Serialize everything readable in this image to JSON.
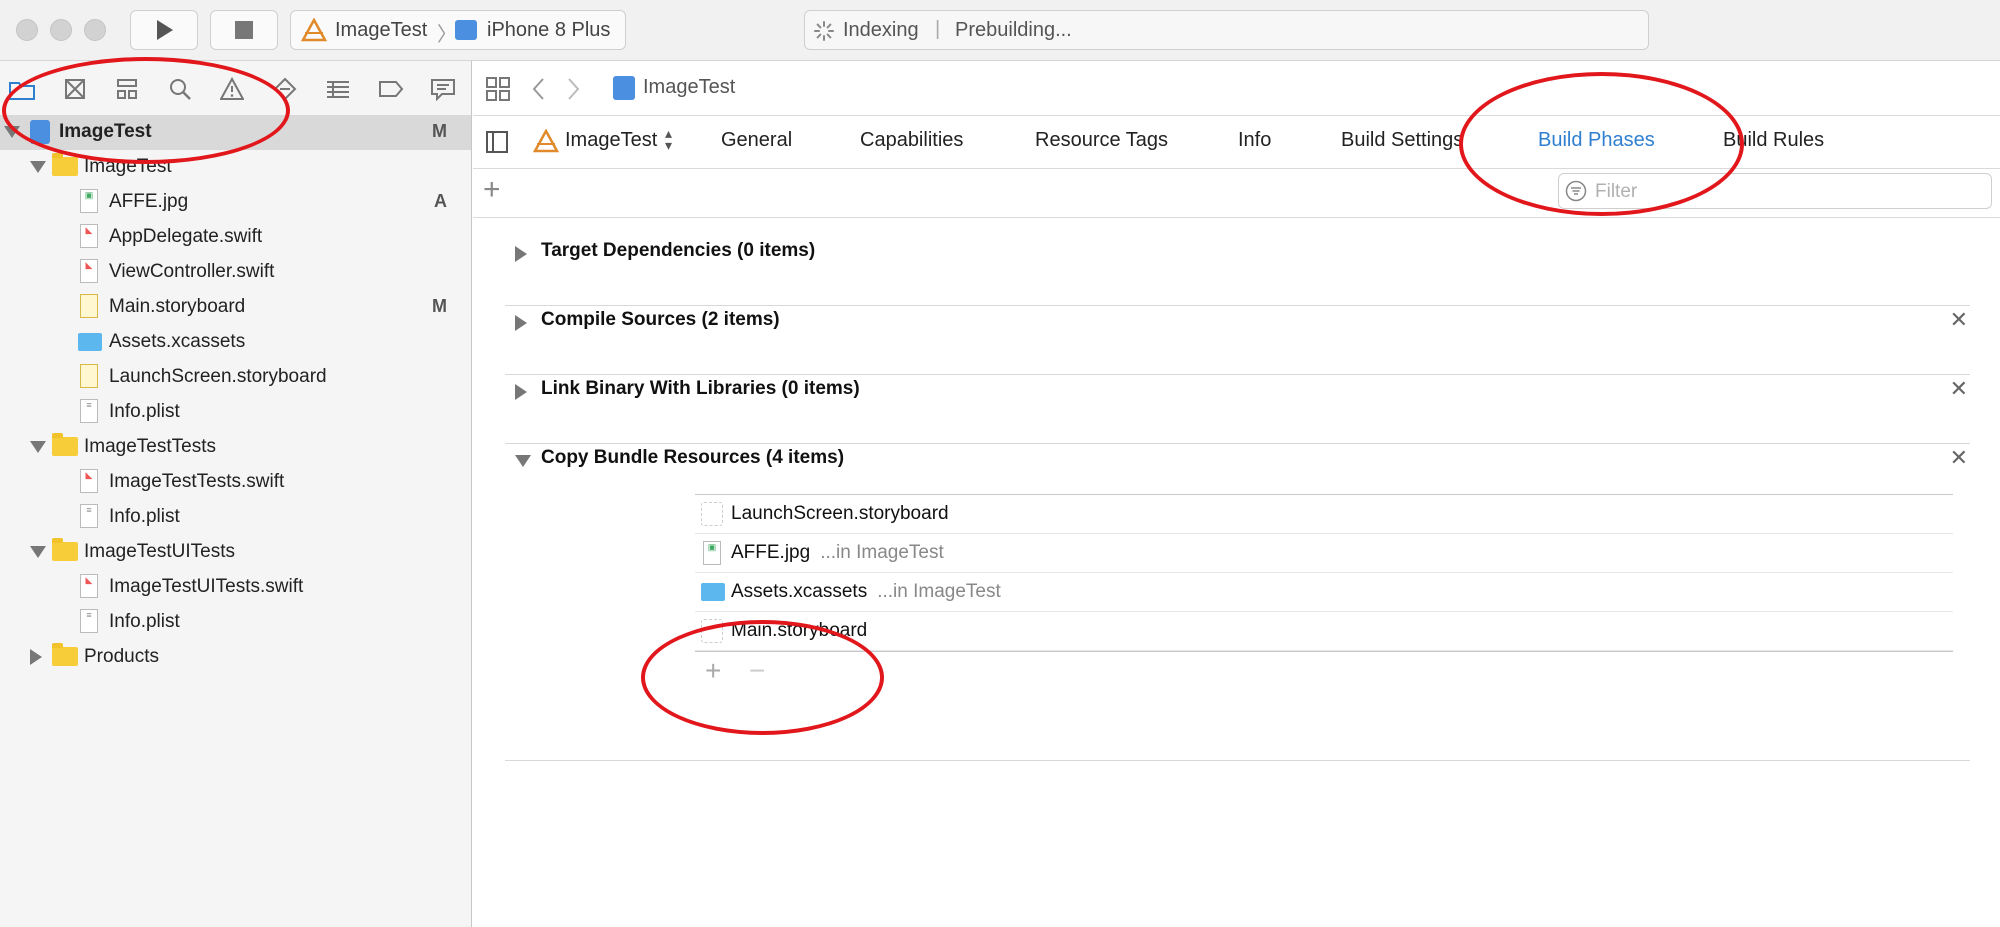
{
  "toolbar": {
    "scheme_target": "ImageTest",
    "scheme_separator": "〉",
    "scheme_device": "iPhone 8 Plus",
    "status_activity": "Indexing",
    "status_separator": "|",
    "status_detail": "Prebuilding..."
  },
  "navigator": {
    "icons": [
      "folder-icon",
      "source-control-icon",
      "symbol-icon",
      "find-icon",
      "issue-warning-icon",
      "test-icon",
      "debug-icon",
      "breakpoint-icon",
      "report-icon"
    ],
    "tree": [
      {
        "label": "ImageTest",
        "badge": "M",
        "kind": "project",
        "depth": 0,
        "expanded": true,
        "selected": true
      },
      {
        "label": "ImageTest",
        "badge": "",
        "kind": "folder",
        "depth": 1,
        "expanded": true
      },
      {
        "label": "AFFE.jpg",
        "badge": "A",
        "kind": "jpg",
        "depth": 2
      },
      {
        "label": "AppDelegate.swift",
        "badge": "",
        "kind": "swift",
        "depth": 2
      },
      {
        "label": "ViewController.swift",
        "badge": "",
        "kind": "swift",
        "depth": 2
      },
      {
        "label": "Main.storyboard",
        "badge": "M",
        "kind": "storyboard",
        "depth": 2
      },
      {
        "label": "Assets.xcassets",
        "badge": "",
        "kind": "xcassets",
        "depth": 2
      },
      {
        "label": "LaunchScreen.storyboard",
        "badge": "",
        "kind": "storyboard",
        "depth": 2
      },
      {
        "label": "Info.plist",
        "badge": "",
        "kind": "plist",
        "depth": 2
      },
      {
        "label": "ImageTestTests",
        "badge": "",
        "kind": "folder",
        "depth": 1,
        "expanded": true
      },
      {
        "label": "ImageTestTests.swift",
        "badge": "",
        "kind": "swift",
        "depth": 2
      },
      {
        "label": "Info.plist",
        "badge": "",
        "kind": "plist",
        "depth": 2
      },
      {
        "label": "ImageTestUITests",
        "badge": "",
        "kind": "folder",
        "depth": 1,
        "expanded": true
      },
      {
        "label": "ImageTestUITests.swift",
        "badge": "",
        "kind": "swift",
        "depth": 2
      },
      {
        "label": "Info.plist",
        "badge": "",
        "kind": "plist",
        "depth": 2
      },
      {
        "label": "Products",
        "badge": "",
        "kind": "folder",
        "depth": 1,
        "expanded": false
      }
    ]
  },
  "editor": {
    "jump_title": "ImageTest",
    "target_name": "ImageTest",
    "tabs": [
      "General",
      "Capabilities",
      "Resource Tags",
      "Info",
      "Build Settings",
      "Build Phases",
      "Build Rules"
    ],
    "active_tab": "Build Phases",
    "filter_placeholder": "Filter",
    "phases": [
      {
        "title": "Target Dependencies (0 items)",
        "expanded": false,
        "closable": false
      },
      {
        "title": "Compile Sources (2 items)",
        "expanded": false,
        "closable": true
      },
      {
        "title": "Link Binary With Libraries (0 items)",
        "expanded": false,
        "closable": true
      },
      {
        "title": "Copy Bundle Resources (4 items)",
        "expanded": true,
        "closable": true
      }
    ],
    "resources": [
      {
        "name": "LaunchScreen.storyboard",
        "location": ""
      },
      {
        "name": "AFFE.jpg",
        "location": "...in ImageTest"
      },
      {
        "name": "Assets.xcassets",
        "location": "...in ImageTest"
      },
      {
        "name": "Main.storyboard",
        "location": ""
      }
    ],
    "add_symbol": "+",
    "remove_symbol": "−",
    "close_symbol": "✕"
  },
  "colors": {
    "accent": "#2f7fd0",
    "annotation": "#e2171c",
    "folder": "#f7ce3a"
  }
}
